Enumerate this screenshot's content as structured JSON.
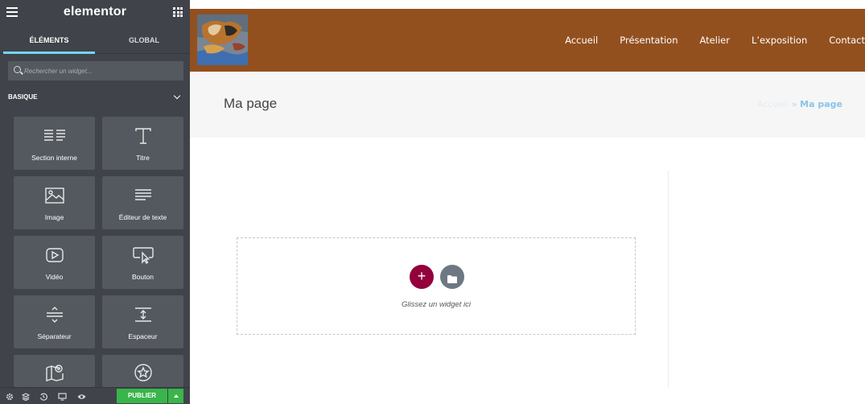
{
  "panel": {
    "brand": "elementor",
    "tabs": [
      {
        "label": "ÉLÉMENTS",
        "active": true
      },
      {
        "label": "GLOBAL",
        "active": false
      }
    ],
    "search": {
      "placeholder": "Rechercher un widget..."
    },
    "category": {
      "label": "BASIQUE"
    },
    "widgets": [
      {
        "label": "Section interne",
        "icon": "columns-icon"
      },
      {
        "label": "Titre",
        "icon": "heading-icon"
      },
      {
        "label": "Image",
        "icon": "image-icon"
      },
      {
        "label": "Éditeur de texte",
        "icon": "text-editor-icon"
      },
      {
        "label": "Vidéo",
        "icon": "video-icon"
      },
      {
        "label": "Bouton",
        "icon": "button-icon"
      },
      {
        "label": "Séparateur",
        "icon": "divider-icon"
      },
      {
        "label": "Espaceur",
        "icon": "spacer-icon"
      },
      {
        "label": "",
        "icon": "map-icon"
      },
      {
        "label": "",
        "icon": "star-icon"
      }
    ],
    "bottom_bar": {
      "icons": [
        "settings-icon",
        "navigator-icon",
        "history-icon",
        "responsive-icon",
        "preview-icon"
      ],
      "publish_label": "PUBLIER"
    },
    "colors": {
      "panel_bg": "#404349",
      "widget_bg": "#54595f",
      "tab_accent": "#71d7f7",
      "publish": "#39b54a"
    }
  },
  "site": {
    "nav": [
      "Accueil",
      "Présentation",
      "Atelier",
      "L’exposition",
      "Contact"
    ],
    "page_title": "Ma page",
    "breadcrumb": {
      "home": "Accueil",
      "separator": "»",
      "current": "Ma page"
    },
    "dropzone": {
      "add_symbol": "+",
      "hint": "Glissez un widget ici"
    },
    "colors": {
      "header_bg": "#93501f",
      "add_button": "#93003c",
      "template_button": "#6d7882",
      "titlebar_bg": "#f6f6f6"
    }
  }
}
